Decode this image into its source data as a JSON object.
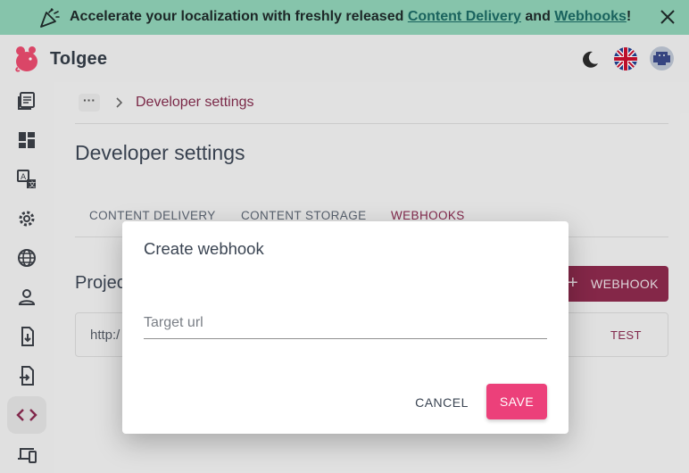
{
  "banner": {
    "text_before": "Accelerate your localization with freshly released ",
    "link1": "Content Delivery",
    "text_mid": " and ",
    "link2": "Webhooks",
    "text_after": "!",
    "color": "#8fd1b6"
  },
  "app": {
    "brand": "Tolgee",
    "accent": "#ec407a"
  },
  "breadcrumb": {
    "more": "···",
    "current": "Developer settings"
  },
  "page": {
    "title": "Developer settings",
    "tabs": [
      "CONTENT DELIVERY",
      "CONTENT STORAGE",
      "WEBHOOKS"
    ],
    "active_tab": "WEBHOOKS",
    "section_label": "Projec",
    "add_button": "WEBHOOK",
    "webhook_row": {
      "url": "http:/",
      "test_label": "TEST"
    }
  },
  "sidebar": {
    "icons": [
      "translations-icon",
      "dashboard-icon",
      "languages-icon",
      "settings-icon",
      "globe-icon",
      "members-icon",
      "import-icon",
      "export-icon",
      "developer-icon",
      "devices-icon"
    ],
    "active": "developer-icon"
  },
  "dialog": {
    "title": "Create webhook",
    "input_placeholder": "Target url",
    "cancel": "CANCEL",
    "save": "SAVE"
  }
}
